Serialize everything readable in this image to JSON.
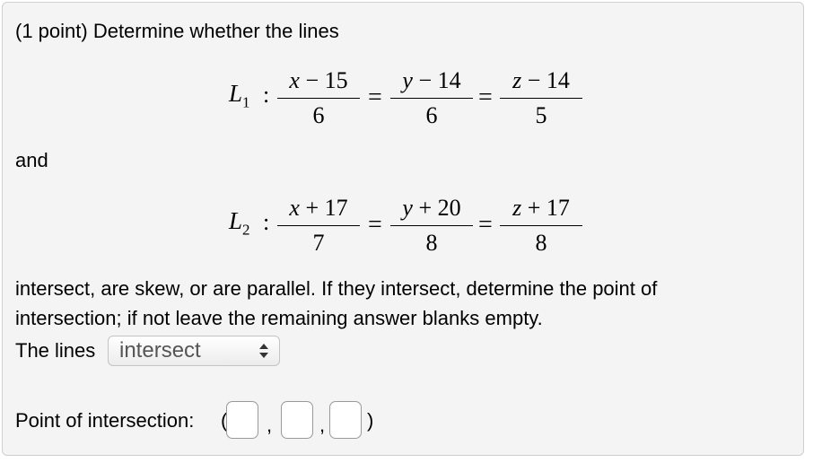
{
  "problem": {
    "intro": "(1 point) Determine whether the lines",
    "and": "and",
    "instructions_line1": "intersect, are skew, or are parallel. If they intersect, determine the point of",
    "instructions_line2": "intersection; if not leave the remaining answer blanks empty."
  },
  "line1": {
    "name": "L",
    "sub": "1",
    "colon": ":",
    "fractions": [
      {
        "var": "x",
        "op": " − ",
        "num": "15",
        "den": "6"
      },
      {
        "var": "y",
        "op": " − ",
        "num": "14",
        "den": "6"
      },
      {
        "var": "z",
        "op": " − ",
        "num": "14",
        "den": "5"
      }
    ],
    "equals": "="
  },
  "line2": {
    "name": "L",
    "sub": "2",
    "colon": ":",
    "fractions": [
      {
        "var": "x",
        "op": " + ",
        "num": "17",
        "den": "7"
      },
      {
        "var": "y",
        "op": " + ",
        "num": "20",
        "den": "8"
      },
      {
        "var": "z",
        "op": " + ",
        "num": "17",
        "den": "8"
      }
    ],
    "equals": "="
  },
  "answer": {
    "lines_label": "The lines",
    "select_value": "intersect",
    "point_label": "Point of intersection:",
    "open_paren": "(",
    "comma": ",",
    "close_paren": ")",
    "inputs": [
      "",
      "",
      ""
    ]
  }
}
